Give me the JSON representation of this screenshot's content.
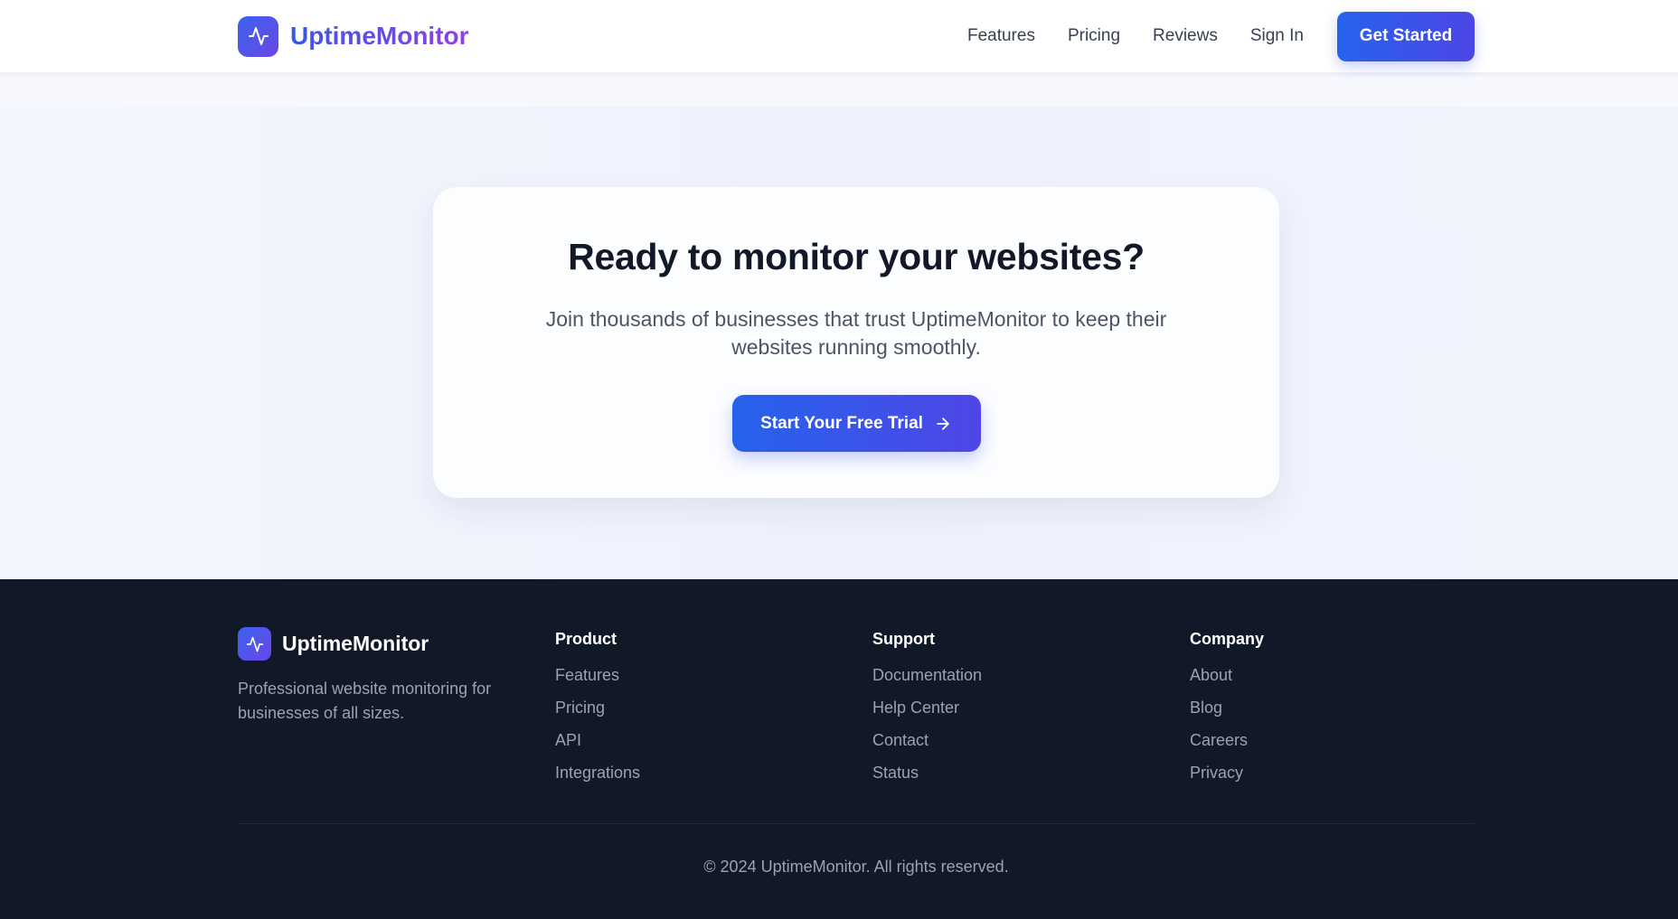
{
  "header": {
    "brand": "UptimeMonitor",
    "brand_icon": "activity-icon",
    "nav": [
      "Features",
      "Pricing",
      "Reviews",
      "Sign In"
    ],
    "cta": "Get Started"
  },
  "hero": {
    "title": "Ready to monitor your websites?",
    "text": "Join thousands of businesses that trust UptimeMonitor to keep their websites running smoothly.",
    "cta": "Start Your Free Trial",
    "cta_icon": "arrow-right-icon"
  },
  "footer": {
    "brand": "UptimeMonitor",
    "tagline": "Professional website monitoring for businesses of all sizes.",
    "columns": [
      {
        "title": "Product",
        "links": [
          "Features",
          "Pricing",
          "API",
          "Integrations"
        ]
      },
      {
        "title": "Support",
        "links": [
          "Documentation",
          "Help Center",
          "Contact",
          "Status"
        ]
      },
      {
        "title": "Company",
        "links": [
          "About",
          "Blog",
          "Careers",
          "Privacy"
        ]
      }
    ],
    "copyright": "© 2024 UptimeMonitor. All rights reserved."
  },
  "colors": {
    "primary": "#2563eb",
    "secondary": "#4f46e5",
    "footer_bg": "#111827",
    "text_dark": "#111827",
    "text_muted": "#9ca3af"
  }
}
